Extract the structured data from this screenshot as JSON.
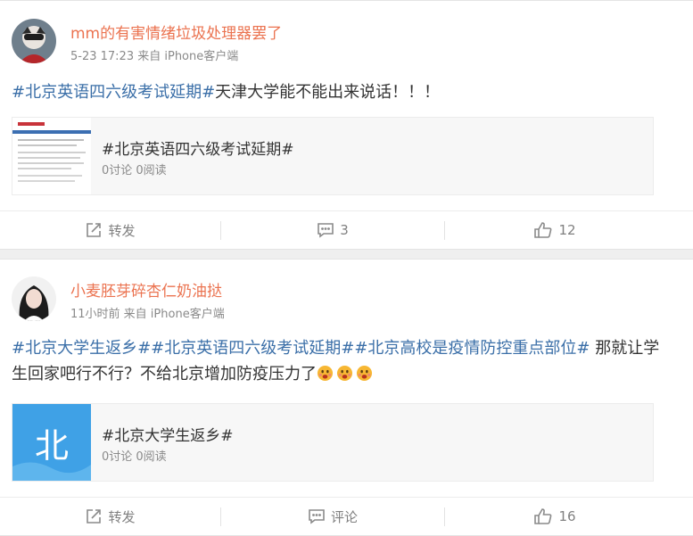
{
  "posts": [
    {
      "author": "mm的有害情绪垃圾处理器罢了",
      "meta": "5-23 17:23 来自 iPhone客户端",
      "text": {
        "topic1": "#北京英语四六级考试延期#",
        "body": "天津大学能不能出来说话！！！"
      },
      "ref": {
        "title": "#北京英语四六级考试延期#",
        "stats": "0讨论 0阅读"
      },
      "actions": {
        "repost": "转发",
        "comment": "3",
        "like": "12"
      }
    },
    {
      "author": "小麦胚芽碎杏仁奶油挞",
      "meta": "11小时前 来自 iPhone客户端",
      "text": {
        "topic1": "#北京大学生返乡#",
        "topic2": "#北京英语四六级考试延期#",
        "topic3": "#北京高校是疫情防控重点部位#",
        "body": " 那就让学生回家吧行不行？不给北京增加防疫压力了"
      },
      "ref": {
        "title": "#北京大学生返乡#",
        "stats": "0讨论 0阅读",
        "thumb_char": "北"
      },
      "actions": {
        "repost": "转发",
        "comment": "评论",
        "like": "16"
      }
    }
  ],
  "colors": {
    "author": "#eb7350",
    "topic": "#3b6fa8",
    "meta": "#8a8a8a",
    "thumb_blue": "#3fa1e6"
  },
  "icons": {
    "repost": "share-icon",
    "comment": "comment-icon",
    "like": "thumbs-up-icon",
    "emoji": "worried-face-emoji"
  }
}
